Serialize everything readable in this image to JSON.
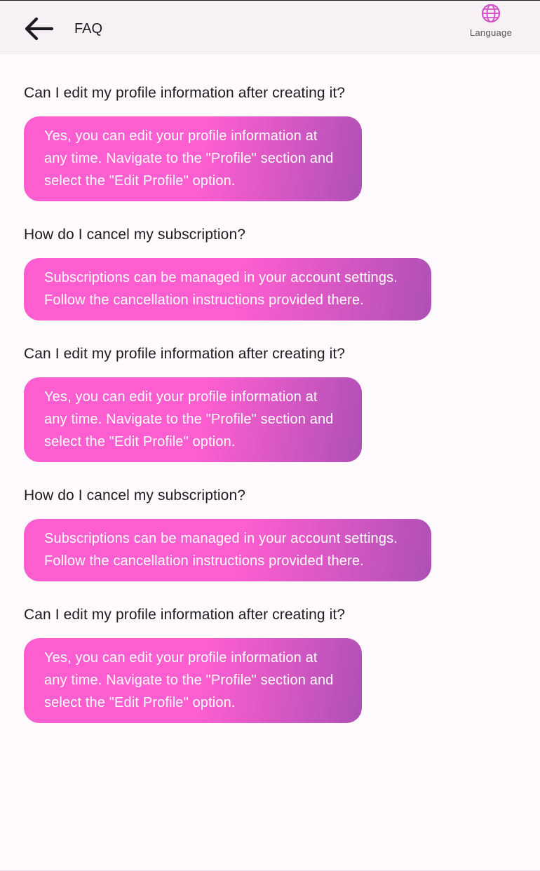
{
  "header": {
    "title": "FAQ",
    "language_label": "Language",
    "back_icon": "arrow-left-icon",
    "language_icon": "globe-icon",
    "accent_color": "#d553c8"
  },
  "faqs": [
    {
      "question": "Can I edit my profile information after creating it?",
      "answer": "Yes, you can edit your profile information at any time. Navigate to the \"Profile\" section and select the \"Edit Profile\" option."
    },
    {
      "question": "How do I cancel my subscription?",
      "answer": "Subscriptions can be managed in your account settings. Follow the cancellation instructions provided there."
    },
    {
      "question": "Can I edit my profile information after creating it?",
      "answer": "Yes, you can edit your profile information at any time. Navigate to the \"Profile\" section and select the \"Edit Profile\" option."
    },
    {
      "question": "How do I cancel my subscription?",
      "answer": "Subscriptions can be managed in your account settings. Follow the cancellation instructions provided there."
    },
    {
      "question": "Can I edit my profile information after creating it?",
      "answer": "Yes, you can edit your profile information at any time. Navigate to the \"Profile\" section and select the \"Edit Profile\" option."
    }
  ],
  "colors": {
    "answer_gradient_start": "#ff5ed0",
    "answer_gradient_end": "#ae50b6",
    "appbar_background": "#f7f1f6",
    "page_background": "#fffafd"
  }
}
